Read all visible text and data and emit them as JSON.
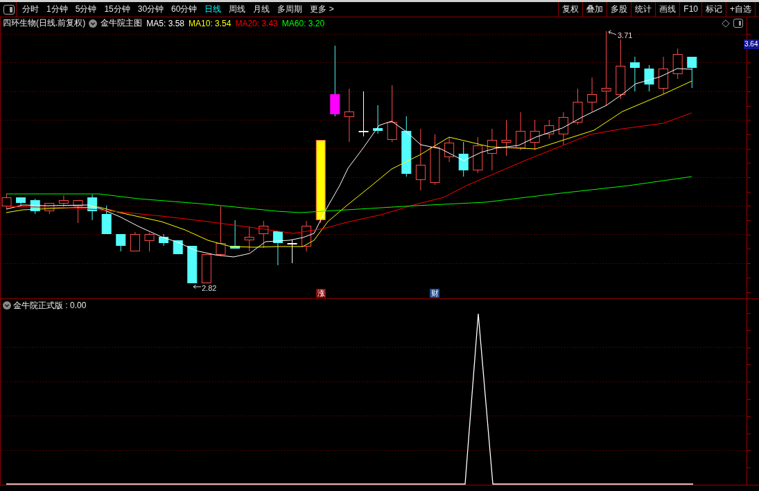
{
  "toolbar": {
    "periods": [
      {
        "label": "分时",
        "selected": false
      },
      {
        "label": "1分钟",
        "selected": false
      },
      {
        "label": "5分钟",
        "selected": false
      },
      {
        "label": "15分钟",
        "selected": false
      },
      {
        "label": "30分钟",
        "selected": false
      },
      {
        "label": "60分钟",
        "selected": false
      },
      {
        "label": "日线",
        "selected": true
      },
      {
        "label": "周线",
        "selected": false
      },
      {
        "label": "月线",
        "selected": false
      },
      {
        "label": "多周期",
        "selected": false
      },
      {
        "label": "更多 >",
        "selected": false
      }
    ],
    "actions": [
      "复权",
      "叠加",
      "多股",
      "统计",
      "画线",
      "F10",
      "标记",
      "+自选"
    ]
  },
  "main_chart": {
    "stock_title": "四环生物(日线.前复权)",
    "indicator_name": "金牛院主图",
    "moving_averages": [
      {
        "label": "MA5: 3.58",
        "color": "#ffffff"
      },
      {
        "label": "MA10: 3.54",
        "color": "#ffff00"
      },
      {
        "label": "MA20: 3.43",
        "color": "#ff0000"
      },
      {
        "label": "MA60: 3.20",
        "color": "#00ff00"
      }
    ],
    "current_price": "3.64",
    "low_label": "2.82",
    "high_label": "3.71",
    "event_badges": [
      {
        "label": "涨",
        "kind": "limit_up"
      },
      {
        "label": "财",
        "kind": "report"
      }
    ]
  },
  "sub_chart": {
    "title": "金牛院正式版 : 0.00"
  }
}
